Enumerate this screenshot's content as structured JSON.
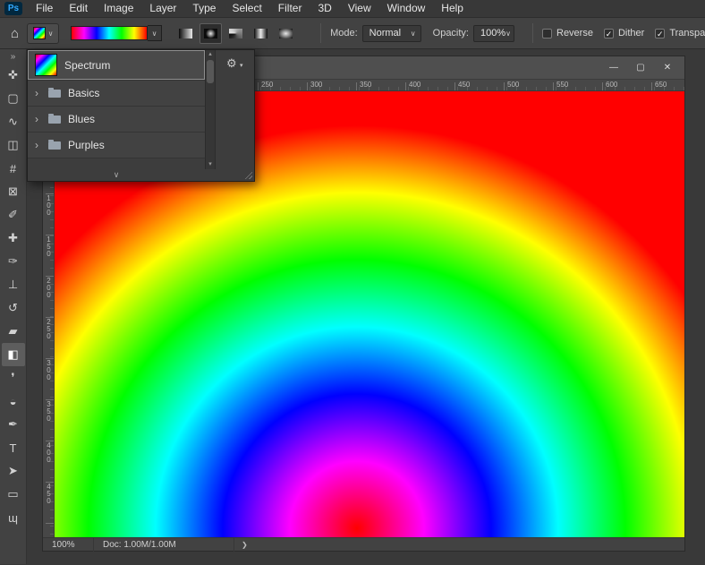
{
  "menubar": {
    "logo": "Ps",
    "items": [
      {
        "label": "File"
      },
      {
        "label": "Edit"
      },
      {
        "label": "Image"
      },
      {
        "label": "Layer"
      },
      {
        "label": "Type"
      },
      {
        "label": "Select"
      },
      {
        "label": "Filter"
      },
      {
        "label": "3D"
      },
      {
        "label": "View"
      },
      {
        "label": "Window"
      },
      {
        "label": "Help"
      }
    ]
  },
  "icons": {
    "home": "⌂",
    "chevron": "∨",
    "expand": "›",
    "gear": "⚙",
    "scroll_up": "▴",
    "scroll_down": "▾",
    "more": "∨"
  },
  "options_bar": {
    "mode_label": "Mode:",
    "mode_value": "Normal",
    "opacity_label": "Opacity:",
    "opacity_value": "100%",
    "gradient_types": [
      "linear",
      "radial",
      "angle",
      "reflected",
      "diamond"
    ],
    "selected_gradient_type": "radial",
    "checkboxes": [
      {
        "label": "Reverse",
        "checked": false
      },
      {
        "label": "Dither",
        "checked": true
      },
      {
        "label": "Transpar",
        "checked": true
      }
    ]
  },
  "gradients": {
    "spectrum_colors": [
      "#ff0000",
      "#ff00ff",
      "#0000ff",
      "#00ffff",
      "#00ff00",
      "#ffff00",
      "#ff0000"
    ]
  },
  "gradient_picker": {
    "selected_item": {
      "label": "Spectrum"
    },
    "folders": [
      {
        "label": "Basics"
      },
      {
        "label": "Blues"
      },
      {
        "label": "Purples"
      }
    ]
  },
  "tools": {
    "selected": "gradient-tool",
    "items": [
      {
        "name": "collapse-panels",
        "glyph": "»"
      },
      {
        "name": "move",
        "glyph": "✜"
      },
      {
        "name": "rectangular-marquee",
        "glyph": "▢"
      },
      {
        "name": "lasso",
        "glyph": "∿"
      },
      {
        "name": "object-selection",
        "glyph": "◫"
      },
      {
        "name": "crop",
        "glyph": "#"
      },
      {
        "name": "frame",
        "glyph": "⊠"
      },
      {
        "name": "eyedropper",
        "glyph": "✐"
      },
      {
        "name": "healing-brush",
        "glyph": "✚"
      },
      {
        "name": "brush",
        "glyph": "✑"
      },
      {
        "name": "clone-stamp",
        "glyph": "⊥"
      },
      {
        "name": "history-brush",
        "glyph": "↺"
      },
      {
        "name": "eraser",
        "glyph": "▰"
      },
      {
        "name": "gradient",
        "glyph": "◧"
      },
      {
        "name": "blur",
        "glyph": "❜"
      },
      {
        "name": "dodge",
        "glyph": "◒"
      },
      {
        "name": "pen",
        "glyph": "✒"
      },
      {
        "name": "type",
        "glyph": "T"
      },
      {
        "name": "path-selection",
        "glyph": "➤"
      },
      {
        "name": "rectangle",
        "glyph": "▭"
      },
      {
        "name": "hand",
        "glyph": "ɰ"
      }
    ]
  },
  "rulers": {
    "horizontal": [
      "250",
      "300",
      "350",
      "400",
      "450",
      "500",
      "550",
      "600",
      "650"
    ],
    "vertical": [
      "100",
      "150",
      "200",
      "250",
      "300",
      "350",
      "400",
      "450"
    ]
  },
  "window_controls": {
    "minimize": "—",
    "maximize": "▢",
    "close": "✕"
  },
  "status_bar": {
    "zoom": "100%",
    "doc_info": "Doc: 1.00M/1.00M",
    "chevron": "❯"
  },
  "canvas": {
    "gradient_type": "radial",
    "center_x": "48%",
    "center_y": "98%",
    "stops": [
      {
        "color": "#ff0000",
        "radius": "0px"
      },
      {
        "color": "#ff00ff",
        "radius": "75px"
      },
      {
        "color": "#0000ff",
        "radius": "150px"
      },
      {
        "color": "#00ffff",
        "radius": "225px"
      },
      {
        "color": "#00ff00",
        "radius": "300px"
      },
      {
        "color": "#ffff00",
        "radius": "375px"
      },
      {
        "color": "#ff0000",
        "radius": "450px"
      }
    ]
  }
}
